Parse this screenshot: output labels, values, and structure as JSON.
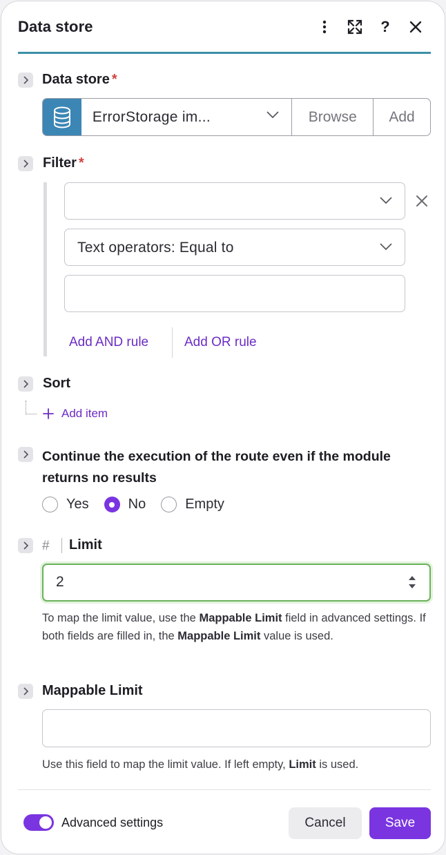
{
  "header": {
    "title": "Data store",
    "icons": [
      "more-vertical-icon",
      "expand-icon",
      "help-icon",
      "close-icon"
    ]
  },
  "data_store": {
    "label": "Data store",
    "required": "*",
    "value": "ErrorStorage im...",
    "browse_label": "Browse",
    "add_label": "Add"
  },
  "filter": {
    "label": "Filter",
    "required": "*",
    "field1_value": "",
    "operator_value": "Text operators: Equal to",
    "field3_value": "",
    "add_and_label": "Add AND rule",
    "add_or_label": "Add OR rule"
  },
  "sort": {
    "label": "Sort",
    "add_item_label": "Add item"
  },
  "continue": {
    "label_line1": "Continue the execution of the route even if the module",
    "label_line2": "returns no results",
    "options": [
      "Yes",
      "No",
      "Empty"
    ],
    "selected": "No"
  },
  "limit": {
    "hash": "#",
    "label": "Limit",
    "value": "2",
    "help_pre": "To map the limit value, use the ",
    "help_b1": "Mappable Limit",
    "help_mid": " field in advanced settings. If both fields are filled in, the ",
    "help_b2": "Mappable Limit",
    "help_post": " value is used."
  },
  "mappable_limit": {
    "label": "Mappable Limit",
    "value": "",
    "help_pre": "Use this field to map the limit value. If left empty, ",
    "help_b": "Limit",
    "help_post": " is used."
  },
  "footer": {
    "advanced_label": "Advanced settings",
    "advanced_on": true,
    "cancel_label": "Cancel",
    "save_label": "Save"
  },
  "colors": {
    "accent": "#7a35e0",
    "header_line": "#3b8fa8",
    "datastore_icon_bg": "#3b86b5",
    "required": "#d14343",
    "limit_focus": "#6ab25a"
  }
}
